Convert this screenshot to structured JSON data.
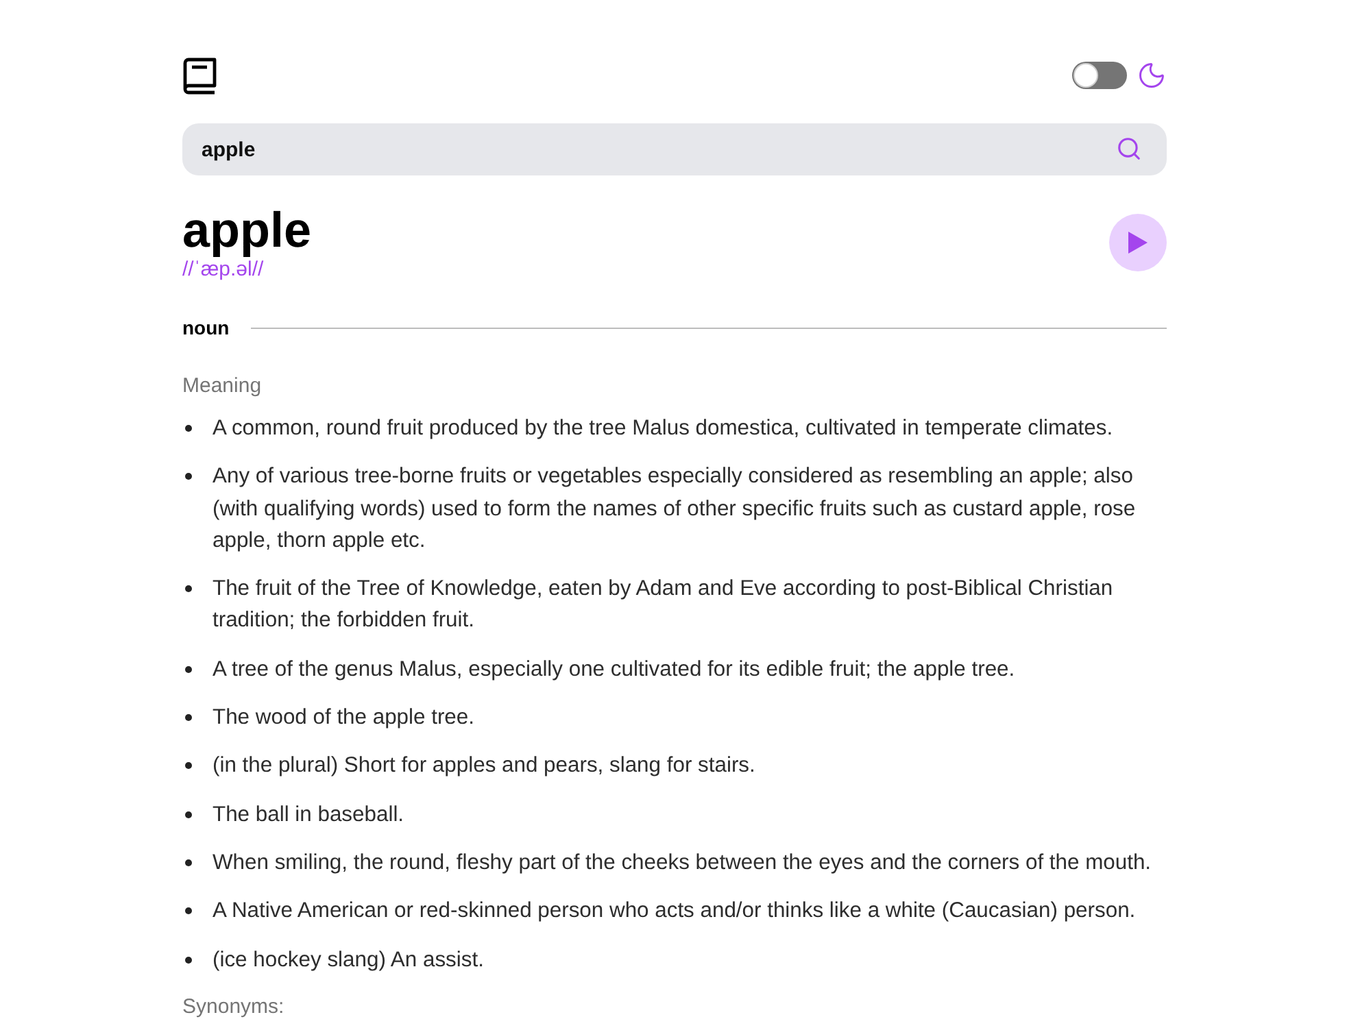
{
  "header": {
    "theme_toggle": {
      "on": false
    }
  },
  "search": {
    "value": "apple"
  },
  "entry": {
    "word": "apple",
    "phonetic": "//ˈæp.əl//"
  },
  "meanings": [
    {
      "part_of_speech": "noun",
      "heading": "Meaning",
      "definitions": [
        "A common, round fruit produced by the tree Malus domestica, cultivated in temperate climates.",
        "Any of various tree-borne fruits or vegetables especially considered as resembling an apple; also (with qualifying words) used to form the names of other specific fruits such as custard apple, rose apple, thorn apple etc.",
        "The fruit of the Tree of Knowledge, eaten by Adam and Eve according to post-Biblical Christian tradition; the forbidden fruit.",
        "A tree of the genus Malus, especially one cultivated for its edible fruit; the apple tree.",
        "The wood of the apple tree.",
        "(in the plural) Short for apples and pears, slang for stairs.",
        "The ball in baseball.",
        "When smiling, the round, fleshy part of the cheeks between the eyes and the corners of the mouth.",
        "A Native American or red-skinned person who acts and/or thinks like a white (Caucasian) person.",
        "(ice hockey slang) An assist."
      ],
      "synonyms_label": "Synonyms:"
    }
  ]
}
